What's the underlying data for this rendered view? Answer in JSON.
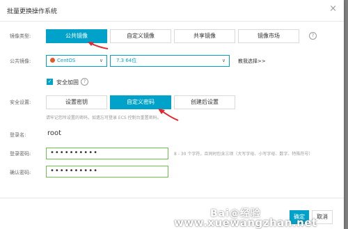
{
  "dialog": {
    "title": "批量更换操作系统",
    "close_icon": "×"
  },
  "image_type": {
    "label": "镜像类型:",
    "options": [
      "公共镜像",
      "自定义镜像",
      "共享镜像",
      "镜像市场"
    ],
    "active": "公共镜像"
  },
  "public_image": {
    "label": "公共镜像:",
    "os_value": "CentOS",
    "version_value": "7.3 64位",
    "help_link": "教我选择>>"
  },
  "security_hardening": {
    "label": "安全加固",
    "checked": true
  },
  "security_settings": {
    "label": "安全设置:",
    "options": [
      "设置密钥",
      "自定义密码",
      "创建后设置"
    ],
    "active": "自定义密码",
    "hint": "请牢记您所设置的密码，如遗忘可登录 ECS 控制台重置密码。"
  },
  "login_name": {
    "label": "登录名:",
    "value": "root"
  },
  "login_password": {
    "label": "登录密码:",
    "value": "••••••••••",
    "hint": "8 - 30 个字符，且同时包含三项（大写字母、小写字母、数字、特殊符号）"
  },
  "confirm_password": {
    "label": "确认密码:",
    "value": "••••••••••"
  },
  "footer": {
    "ok_label": "确定",
    "cancel_label": "取消"
  },
  "watermark": {
    "brand": "Bai@经验",
    "url": "www.xuewangzhan.net"
  },
  "colors": {
    "accent": "#00a2ca",
    "valid": "#6cc24a",
    "arrow": "#e8232a"
  }
}
